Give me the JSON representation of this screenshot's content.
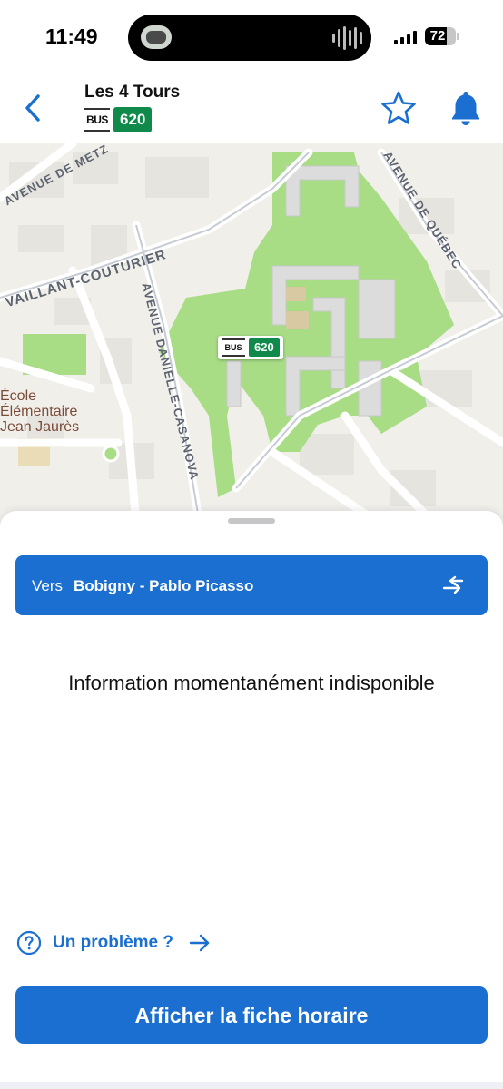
{
  "status_bar": {
    "time": "11:49",
    "battery_level": "72"
  },
  "header": {
    "title": "Les 4 Tours",
    "mode_badge": "BUS",
    "line_number": "620",
    "back_icon": "chevron-left-icon",
    "favorite_icon": "star-icon",
    "alert_icon": "bell-icon"
  },
  "map": {
    "street_labels": [
      "AVENUE DE METZ",
      "VAILLANT-COUTURIER",
      "AVENUE DANIELLE-CASANOVA",
      "AVENUE DE QUÉBEC"
    ],
    "poi": {
      "line1": "École",
      "line2": "Élémentaire",
      "line3": "Jean Jaurès"
    },
    "stop_marker": {
      "mode": "BUS",
      "line": "620"
    }
  },
  "direction": {
    "prefix": "Vers",
    "destination": "Bobigny - Pablo Picasso",
    "swap_icon": "swap-direction-icon"
  },
  "info_message": "Information momentanément indisponible",
  "footer": {
    "problem_label": "Un problème ?",
    "cta_label": "Afficher la fiche horaire"
  },
  "colors": {
    "accent": "#1b6fd0",
    "line_badge": "#0f8a4a",
    "park": "#a8dd86"
  }
}
